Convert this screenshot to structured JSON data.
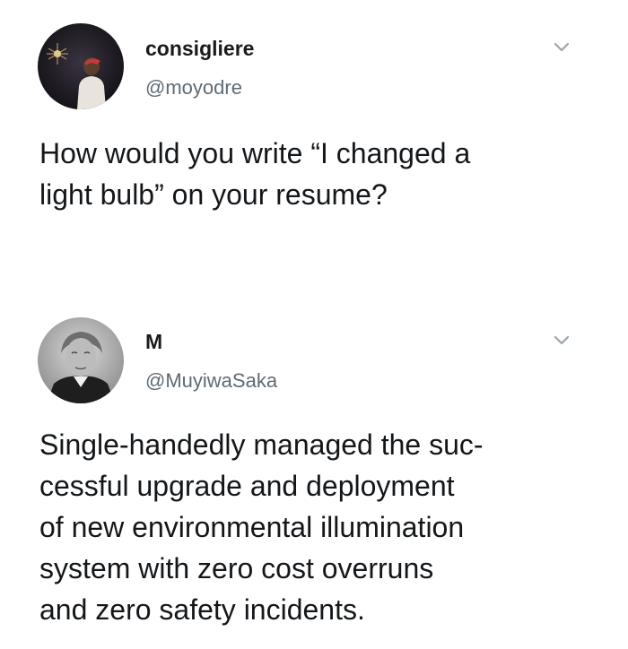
{
  "tweets": [
    {
      "display_name": "consigliere",
      "handle": "@moyodre",
      "text": "How would you write “I changed a\nlight bulb” on your resume?",
      "avatar_icon": "avatar-dark-portrait"
    },
    {
      "display_name": "M",
      "handle": "@MuyiwaSaka",
      "text": "Single-handedly managed the suc-\ncessful upgrade and deployment\nof new environmental illumination\nsystem with zero cost overruns\nand zero safety incidents.",
      "avatar_icon": "avatar-vintage-portrait"
    }
  ],
  "icons": {
    "menu": "chevron-down-icon"
  },
  "colors": {
    "text": "#14171a",
    "handle": "#5f6b75",
    "chevron": "#9aa5ad",
    "background": "#ffffff"
  }
}
